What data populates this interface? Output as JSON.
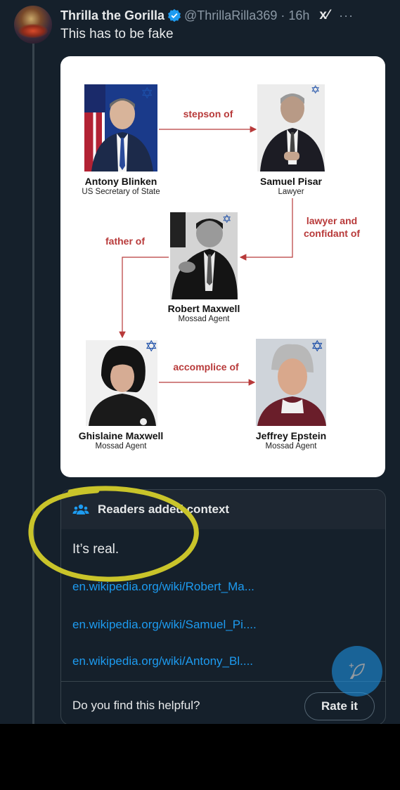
{
  "tweet": {
    "author_name": "Thrilla the Gorilla",
    "handle": "@ThrillaRilla369",
    "separator": "·",
    "time": "16h",
    "grok_label": "x⁄",
    "more_label": "···",
    "text": "This has to be fake"
  },
  "graphic": {
    "people": [
      {
        "name": "Antony Blinken",
        "role": "US Secretary of State"
      },
      {
        "name": "Samuel Pisar",
        "role": "Lawyer"
      },
      {
        "name": "Robert Maxwell",
        "role": "Mossad Agent"
      },
      {
        "name": "Ghislaine Maxwell",
        "role": "Mossad Agent"
      },
      {
        "name": "Jeffrey Epstein",
        "role": "Mossad Agent"
      }
    ],
    "relations": {
      "stepson": "stepson of",
      "lawyer_1": "lawyer and",
      "lawyer_2": "confidant of",
      "father": "father of",
      "accomplice": "accomplice of"
    },
    "star_glyph": "✡"
  },
  "note": {
    "title": "Readers added context",
    "body": "It’s real.",
    "links": [
      "en.wikipedia.org/wiki/Robert_Ma...",
      "en.wikipedia.org/wiki/Samuel_Pi....",
      "en.wikipedia.org/wiki/Antony_Bl...."
    ],
    "helpful_question": "Do you find this helpful?",
    "rate_label": "Rate it"
  },
  "colors": {
    "background": "#15202b",
    "link": "#1d9bf0",
    "relation_text": "#b83a3a",
    "star": "#1d4fa8",
    "highlight_circle": "#c9c42a"
  }
}
